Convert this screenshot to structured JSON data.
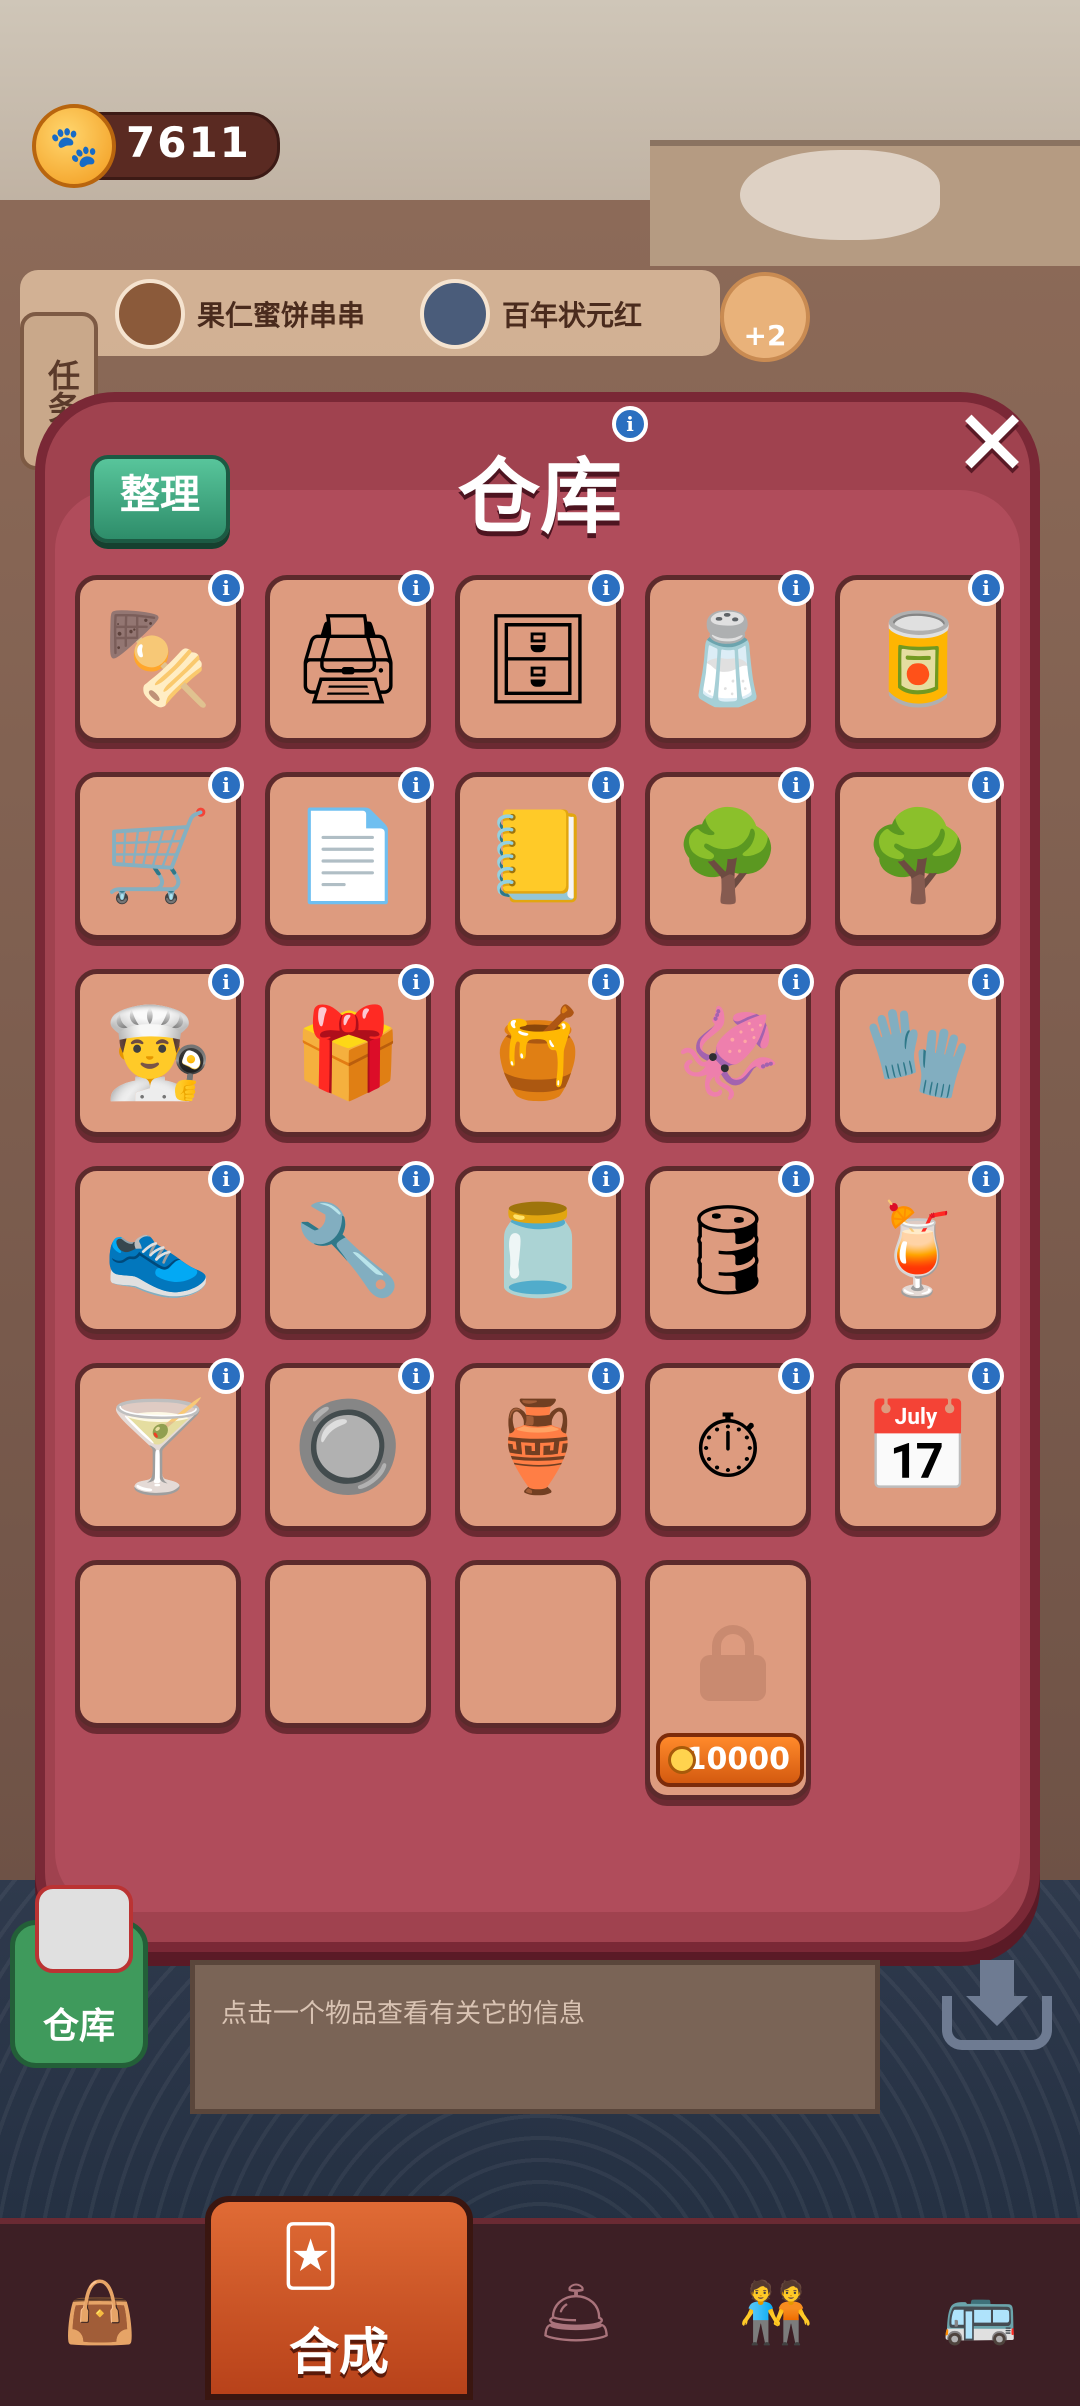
{
  "status": {
    "coins": "7611",
    "coin_icon": "paw-coin-icon"
  },
  "orders": [
    {
      "label": "果仁蜜饼串串"
    },
    {
      "label": "百年状元红"
    }
  ],
  "reward_badge": "+2",
  "task_tab": "任务",
  "modal": {
    "title": "仓库",
    "sort_button": "整理",
    "close_glyph": "✕",
    "info_glyph": "i",
    "unlock_price": "10000",
    "slots": [
      {
        "glyph": "🍢",
        "name": "skewer-grill"
      },
      {
        "glyph": "🖨",
        "name": "receipt-printer"
      },
      {
        "glyph": "🗄",
        "name": "baking-cabinet"
      },
      {
        "glyph": "🧂",
        "name": "spice-shelf"
      },
      {
        "glyph": "🥫",
        "name": "jar-rack"
      },
      {
        "glyph": "🛒",
        "name": "hand-truck"
      },
      {
        "glyph": "📄",
        "name": "paper-stack"
      },
      {
        "glyph": "📒",
        "name": "bear-notebook"
      },
      {
        "glyph": "🌳",
        "name": "small-tree"
      },
      {
        "glyph": "🌳",
        "name": "small-tree-2"
      },
      {
        "glyph": "👨‍🍳",
        "name": "chef-hat"
      },
      {
        "glyph": "🎁",
        "name": "gift-bundle"
      },
      {
        "glyph": "🍯",
        "name": "sauce-jar"
      },
      {
        "glyph": "🦑",
        "name": "dried-squid"
      },
      {
        "glyph": "🧤",
        "name": "work-gloves"
      },
      {
        "glyph": "👟",
        "name": "shoe-covers"
      },
      {
        "glyph": "🔧",
        "name": "power-drill"
      },
      {
        "glyph": "🫙",
        "name": "cream-jar"
      },
      {
        "glyph": "🛢",
        "name": "wine-barrel"
      },
      {
        "glyph": "🍹",
        "name": "sunset-cocktail"
      },
      {
        "glyph": "🍸",
        "name": "lime-cocktail"
      },
      {
        "glyph": "🔘",
        "name": "silver-stopper"
      },
      {
        "glyph": "🏺",
        "name": "copper-stopper"
      },
      {
        "glyph": "⏱",
        "name": "timer-clock"
      },
      {
        "glyph": "📅",
        "name": "calendar-june"
      }
    ]
  },
  "info_panel": {
    "text": "点击一个物品查看有关它的信息"
  },
  "side_button": "仓库",
  "nav": {
    "active_label": "合成",
    "items": [
      {
        "glyph": "👜",
        "name": "nav-bag"
      },
      {
        "glyph": "🛎",
        "name": "nav-service-bell"
      },
      {
        "glyph": "🧑‍🤝‍🧑",
        "name": "nav-staff"
      },
      {
        "glyph": "🚌",
        "name": "nav-bus"
      }
    ]
  },
  "colors": {
    "modal": "#a0424f",
    "slot": "#dd9b7f",
    "info": "#2b6fc0",
    "sort": "#3fae86"
  }
}
